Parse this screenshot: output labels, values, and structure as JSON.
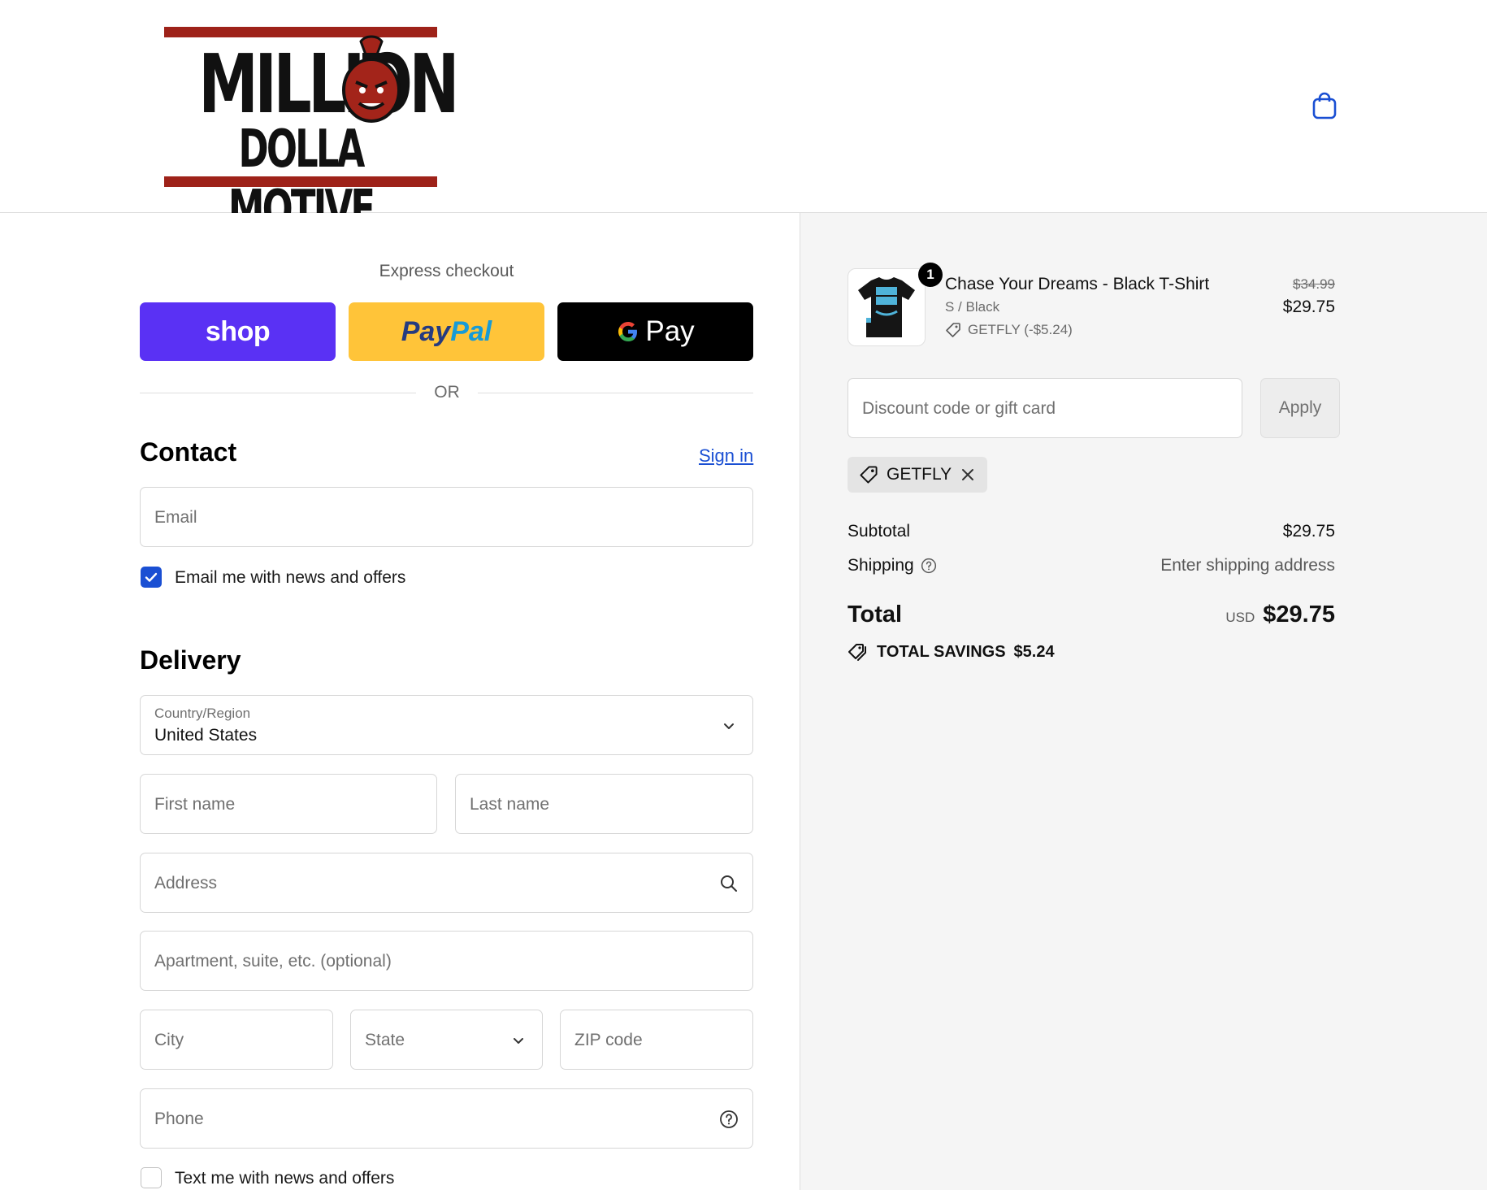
{
  "brand": {
    "logo_line1": "MILLION",
    "logo_line2": "DOLLA MOTIVE",
    "accent_color": "#9e2219"
  },
  "header": {
    "cart_icon": "shopping-bag-icon"
  },
  "express": {
    "title": "Express checkout",
    "shop_label": "shop",
    "paypal_part1": "Pay",
    "paypal_part2": "Pal",
    "gpay_label": "Pay",
    "or_label": "OR"
  },
  "contact": {
    "title": "Contact",
    "sign_in": "Sign in",
    "email_placeholder": "Email",
    "news_checkbox_label": "Email me with news and offers",
    "news_checked": true
  },
  "delivery": {
    "title": "Delivery",
    "country_label": "Country/Region",
    "country_value": "United States",
    "first_name_placeholder": "First name",
    "last_name_placeholder": "Last name",
    "address_placeholder": "Address",
    "apartment_placeholder": "Apartment, suite, etc. (optional)",
    "city_placeholder": "City",
    "state_placeholder": "State",
    "zip_placeholder": "ZIP code",
    "phone_placeholder": "Phone",
    "text_checkbox_label": "Text me with news and offers",
    "text_checked": false
  },
  "summary": {
    "item": {
      "quantity": "1",
      "name": "Chase Your Dreams - Black T-Shirt",
      "variant": "S / Black",
      "discount": "GETFLY (-$5.24)",
      "original_price": "$34.99",
      "price": "$29.75"
    },
    "discount_placeholder": "Discount code or gift card",
    "apply_label": "Apply",
    "applied_code": "GETFLY",
    "subtotal_label": "Subtotal",
    "subtotal_value": "$29.75",
    "shipping_label": "Shipping",
    "shipping_value": "Enter shipping address",
    "total_label": "Total",
    "currency": "USD",
    "total_value": "$29.75",
    "savings_label": "TOTAL SAVINGS",
    "savings_value": "$5.24"
  }
}
